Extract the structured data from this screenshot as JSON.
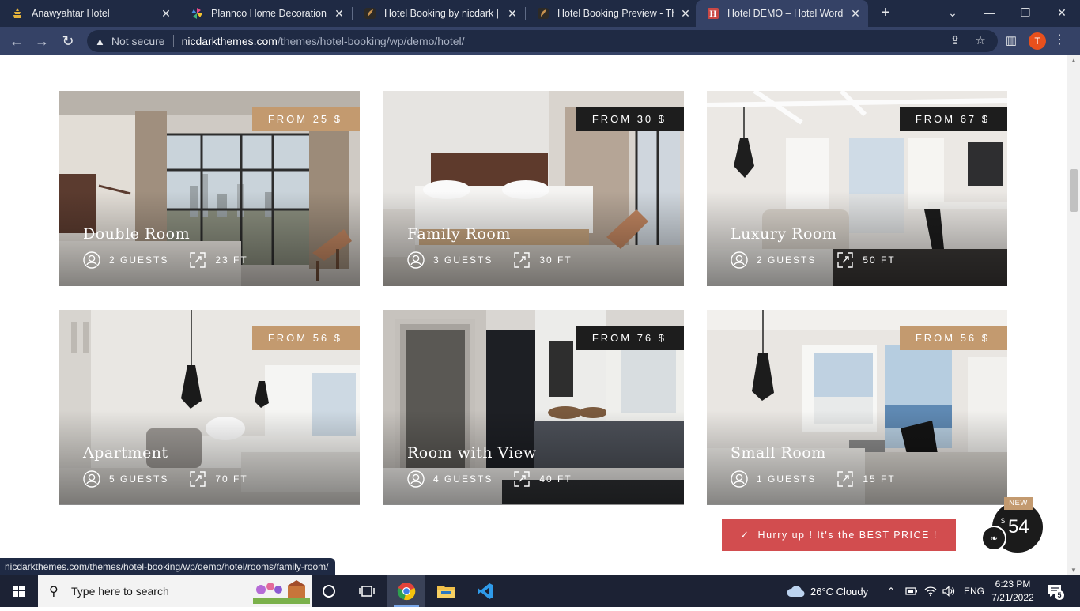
{
  "browser": {
    "tabs": [
      {
        "title": "Anawyahtar Hotel",
        "favicon": "pagoda-icon",
        "active": false
      },
      {
        "title": "Plannco Home Decoration",
        "favicon": "pinwheel-icon",
        "active": false
      },
      {
        "title": "Hotel Booking by nicdark | Th",
        "favicon": "themeforest-icon",
        "active": false
      },
      {
        "title": "Hotel Booking Preview - Ther",
        "favicon": "themeforest-icon",
        "active": false
      },
      {
        "title": "Hotel DEMO – Hotel WordPr",
        "favicon": "hotel-h-icon",
        "active": true
      }
    ],
    "address": {
      "security_label": "Not secure",
      "host": "nicdarkthemes.com",
      "path": "/themes/hotel-booking/wp/demo/hotel/"
    },
    "profile_initial": "T",
    "status_url": "nicdarkthemes.com/themes/hotel-booking/wp/demo/hotel/rooms/family-room/"
  },
  "rooms": [
    {
      "name": "Double Room",
      "price": "FROM 25 $",
      "price_style": "tan",
      "guests": "2 GUESTS",
      "size": "23 FT"
    },
    {
      "name": "Family Room",
      "price": "FROM 30 $",
      "price_style": "dark",
      "guests": "3 GUESTS",
      "size": "30 FT"
    },
    {
      "name": "Luxury Room",
      "price": "FROM 67 $",
      "price_style": "dark",
      "guests": "2 GUESTS",
      "size": "50 FT"
    },
    {
      "name": "Apartment",
      "price": "FROM 56 $",
      "price_style": "tan",
      "guests": "5 GUESTS",
      "size": "70 FT"
    },
    {
      "name": "Room with View",
      "price": "FROM 76 $",
      "price_style": "dark",
      "guests": "4 GUESTS",
      "size": "40 FT"
    },
    {
      "name": "Small Room",
      "price": "FROM 56 $",
      "price_style": "tan",
      "guests": "1 GUESTS",
      "size": "15 FT"
    }
  ],
  "promo": {
    "hurry_text": "Hurry up ! It's the BEST PRICE !",
    "badge_new": "NEW",
    "badge_currency": "$",
    "badge_value": "54"
  },
  "taskbar": {
    "search_placeholder": "Type here to search",
    "weather": "26°C  Cloudy",
    "language": "ENG",
    "time": "6:23 PM",
    "date": "7/21/2022",
    "notification_count": "5"
  },
  "colors": {
    "price_tan": "#c39a6f",
    "price_dark": "#1d1d1d",
    "hurry_red": "#d24d4f",
    "chrome_dark": "#1f2a44",
    "chrome_toolbar": "#354266"
  }
}
